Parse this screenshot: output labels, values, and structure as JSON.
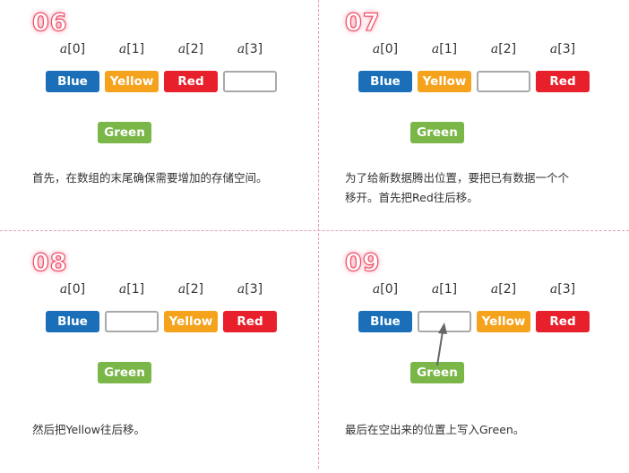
{
  "colors": {
    "Blue": "#1a6fb8",
    "Yellow": "#f5a21d",
    "Red": "#e8202c",
    "Green": "#7ab648",
    "step_number": "#ef4f68",
    "divider": "#e7a0ad"
  },
  "index_labels": [
    {
      "var": "a",
      "idx": "[0]"
    },
    {
      "var": "a",
      "idx": "[1]"
    },
    {
      "var": "a",
      "idx": "[2]"
    },
    {
      "var": "a",
      "idx": "[3]"
    }
  ],
  "panels": [
    {
      "step": "06",
      "cells": [
        "Blue",
        "Yellow",
        "Red",
        ""
      ],
      "new_element": "Green",
      "arrow": false,
      "caption": [
        "首先，在数组的末尾确保需要增加的存储空间。"
      ]
    },
    {
      "step": "07",
      "cells": [
        "Blue",
        "Yellow",
        "",
        "Red"
      ],
      "new_element": "Green",
      "arrow": false,
      "caption": [
        "为了给新数据腾出位置，要把已有数据一个个",
        "移开。首先把Red往后移。"
      ]
    },
    {
      "step": "08",
      "cells": [
        "Blue",
        "",
        "Yellow",
        "Red"
      ],
      "new_element": "Green",
      "arrow": false,
      "caption": [
        "然后把Yellow往后移。"
      ]
    },
    {
      "step": "09",
      "cells": [
        "Blue",
        "",
        "Yellow",
        "Red"
      ],
      "new_element": "Green",
      "arrow": true,
      "caption": [
        "最后在空出来的位置上写入Green。"
      ]
    }
  ]
}
